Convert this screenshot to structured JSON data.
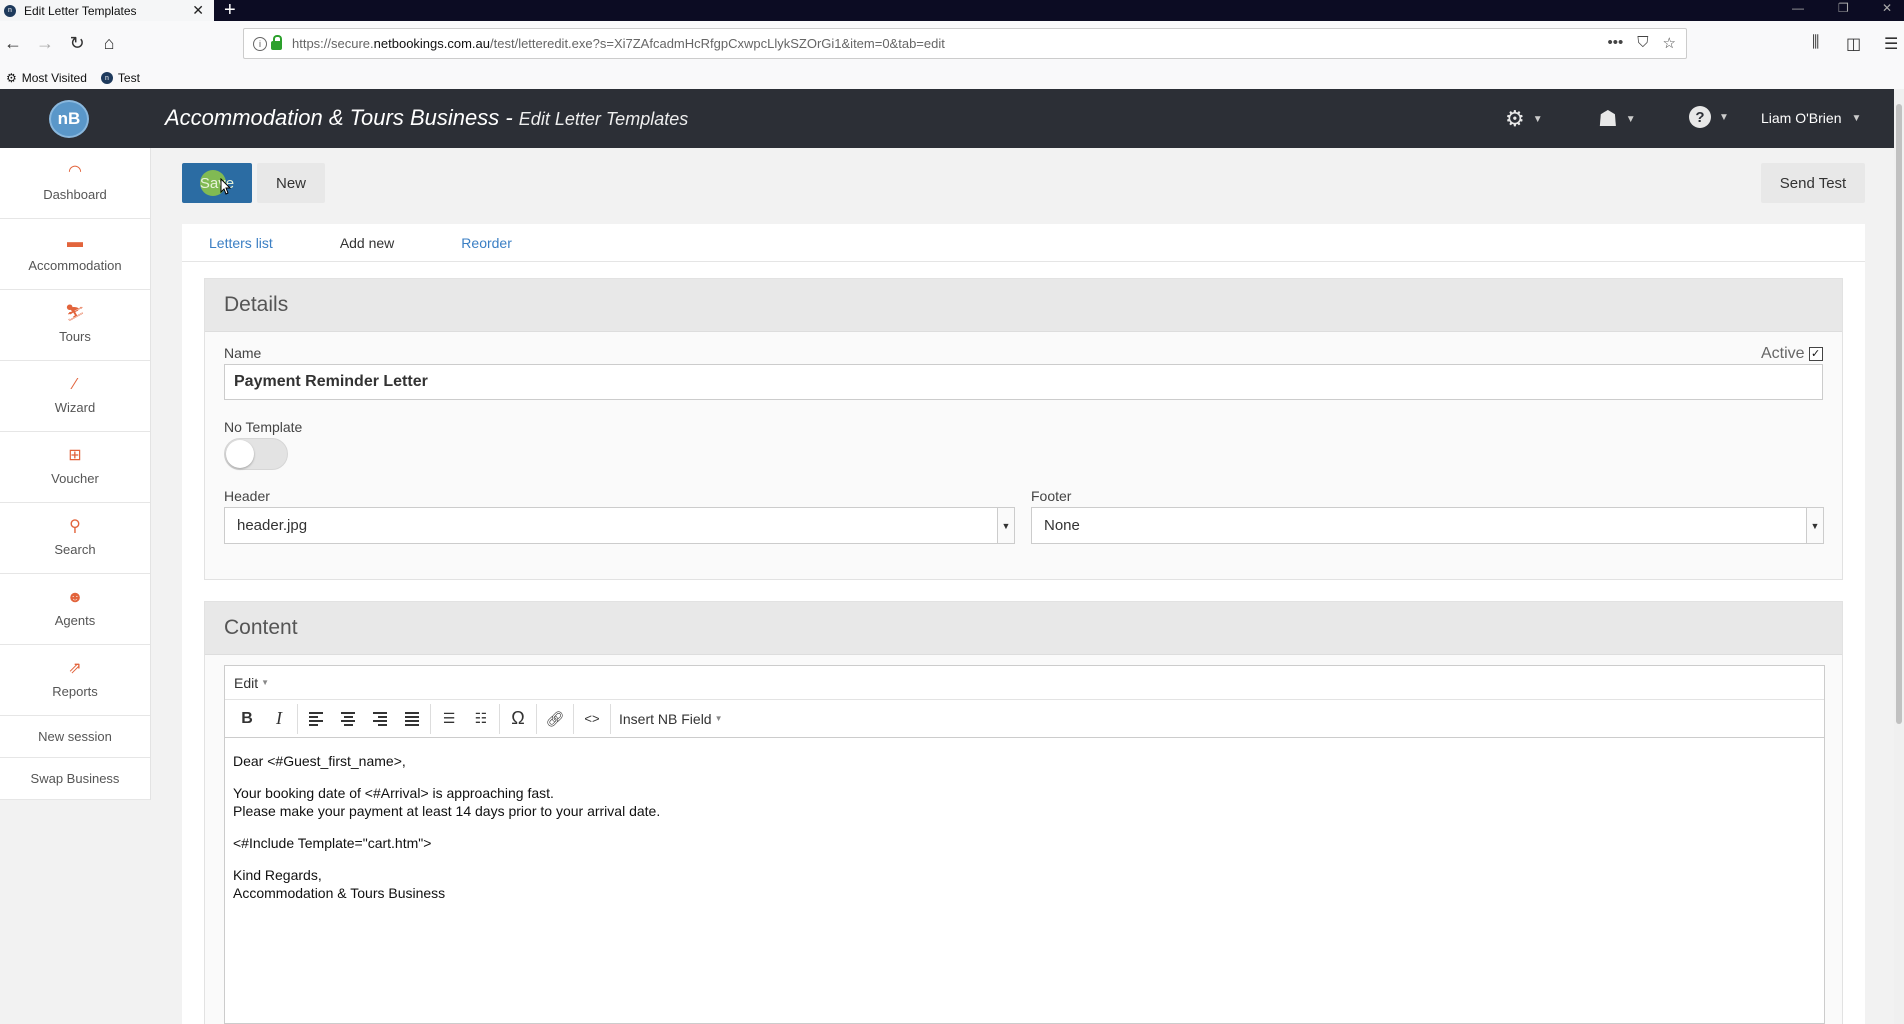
{
  "browser": {
    "tab_title": "Edit Letter Templates",
    "tab_close": "✕",
    "new_tab": "+",
    "url_prefix": "https://secure.",
    "url_host": "netbookings.com.au",
    "url_path": "/test/letteredit.exe?s=Xi7ZAfcadmHcRfgpCxwpcLlykSZOrGi1&item=0&tab=edit",
    "bookmarks": [
      {
        "label": "Most Visited"
      },
      {
        "label": "Test"
      }
    ]
  },
  "app": {
    "logo_text": "nB",
    "title": "Accommodation & Tours Business",
    "separator": " - ",
    "subtitle": "Edit Letter Templates",
    "user_name": "Liam O'Brien"
  },
  "sidebar": {
    "items": [
      {
        "label": "Dashboard",
        "icon": "gauge-icon"
      },
      {
        "label": "Accommodation",
        "icon": "bed-icon"
      },
      {
        "label": "Tours",
        "icon": "hiker-icon"
      },
      {
        "label": "Wizard",
        "icon": "wand-icon"
      },
      {
        "label": "Voucher",
        "icon": "gift-icon"
      },
      {
        "label": "Search",
        "icon": "search-icon"
      },
      {
        "label": "Agents",
        "icon": "agent-icon"
      },
      {
        "label": "Reports",
        "icon": "chart-icon"
      }
    ],
    "links": [
      {
        "label": "New session"
      },
      {
        "label": "Swap Business"
      }
    ]
  },
  "toolbar": {
    "save_label": "Save",
    "new_label": "New",
    "send_test_label": "Send Test"
  },
  "tabs": [
    {
      "label": "Letters list"
    },
    {
      "label": "Add new"
    },
    {
      "label": "Reorder"
    }
  ],
  "details": {
    "heading": "Details",
    "name_label": "Name",
    "name_value": "Payment Reminder Letter",
    "active_label": "Active",
    "active_checked": true,
    "no_template_label": "No Template",
    "no_template_on": false,
    "header_label": "Header",
    "header_value": "header.jpg",
    "footer_label": "Footer",
    "footer_value": "None"
  },
  "content": {
    "heading": "Content",
    "edit_menu": "Edit",
    "insert_field": "Insert NB Field",
    "body": {
      "greeting": "Dear <#Guest_first_name>,",
      "line1": "Your booking date of <#Arrival> is approaching fast.",
      "line2": "Please make your payment at least 14 days prior to your arrival date.",
      "include": "<#Include Template=\"cart.htm\">",
      "signoff": "Kind Regards,",
      "signature": "Accommodation & Tours Business"
    }
  }
}
